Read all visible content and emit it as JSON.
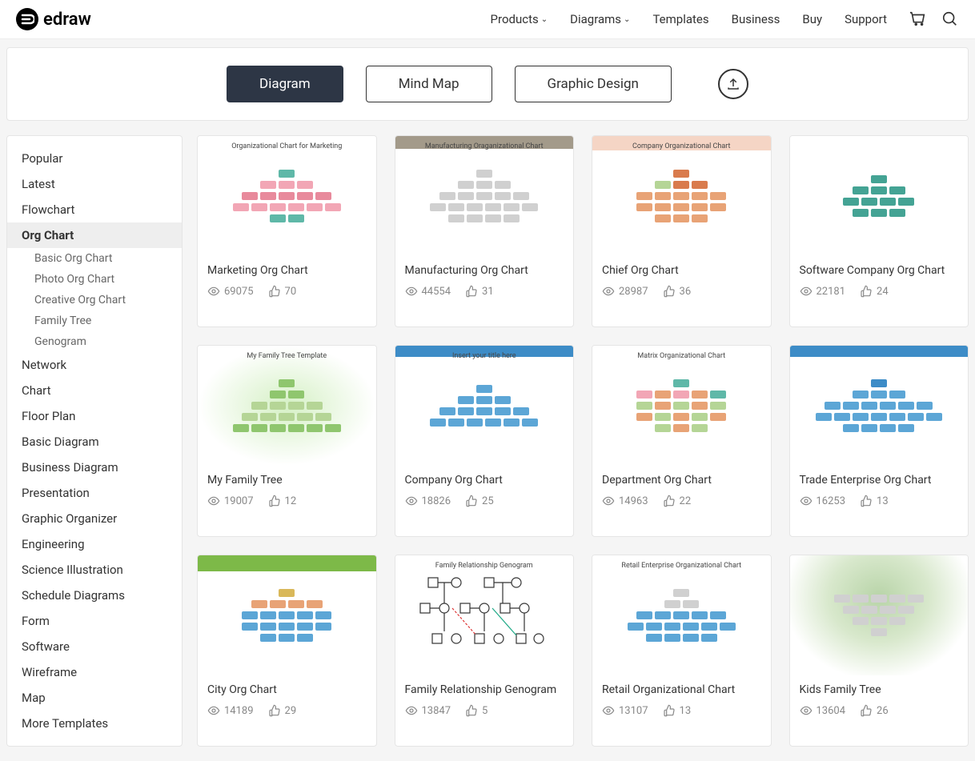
{
  "header": {
    "logo_text": "edraw",
    "nav": [
      "Products",
      "Diagrams",
      "Templates",
      "Business",
      "Buy",
      "Support"
    ],
    "nav_dropdown": [
      true,
      true,
      false,
      false,
      false,
      false
    ]
  },
  "tabs": {
    "items": [
      "Diagram",
      "Mind Map",
      "Graphic Design"
    ],
    "active_index": 0
  },
  "sidebar": {
    "items": [
      {
        "label": "Popular",
        "type": "item"
      },
      {
        "label": "Latest",
        "type": "item"
      },
      {
        "label": "Flowchart",
        "type": "item"
      },
      {
        "label": "Org Chart",
        "type": "item",
        "active": true
      },
      {
        "label": "Basic Org Chart",
        "type": "sub"
      },
      {
        "label": "Photo Org Chart",
        "type": "sub"
      },
      {
        "label": "Creative Org Chart",
        "type": "sub"
      },
      {
        "label": "Family Tree",
        "type": "sub"
      },
      {
        "label": "Genogram",
        "type": "sub"
      },
      {
        "label": "Network",
        "type": "item"
      },
      {
        "label": "Chart",
        "type": "item"
      },
      {
        "label": "Floor Plan",
        "type": "item"
      },
      {
        "label": "Basic Diagram",
        "type": "item"
      },
      {
        "label": "Business Diagram",
        "type": "item"
      },
      {
        "label": "Presentation",
        "type": "item"
      },
      {
        "label": "Graphic Organizer",
        "type": "item"
      },
      {
        "label": "Engineering",
        "type": "item"
      },
      {
        "label": "Science Illustration",
        "type": "item"
      },
      {
        "label": "Schedule Diagrams",
        "type": "item"
      },
      {
        "label": "Form",
        "type": "item"
      },
      {
        "label": "Software",
        "type": "item"
      },
      {
        "label": "Wireframe",
        "type": "item"
      },
      {
        "label": "Map",
        "type": "item"
      },
      {
        "label": "More Templates",
        "type": "item"
      }
    ]
  },
  "templates": [
    {
      "title": "Marketing Org Chart",
      "views": "69075",
      "likes": "70",
      "thumb_label": "Organizational Chart for Marketing",
      "style": "pink"
    },
    {
      "title": "Manufacturing Org Chart",
      "views": "44554",
      "likes": "31",
      "thumb_label": "Manufacturing Oraganizational Chart",
      "style": "gray"
    },
    {
      "title": "Chief Org Chart",
      "views": "28987",
      "likes": "36",
      "thumb_label": "Company Organizational Chart",
      "style": "orange"
    },
    {
      "title": "Software Company Org Chart",
      "views": "22181",
      "likes": "24",
      "thumb_label": "",
      "style": "teal"
    },
    {
      "title": "My Family Tree",
      "views": "19007",
      "likes": "12",
      "thumb_label": "My Family Tree Template",
      "style": "tree"
    },
    {
      "title": "Company Org Chart",
      "views": "18826",
      "likes": "25",
      "thumb_label": "Insert your title here",
      "style": "bluephoto"
    },
    {
      "title": "Department Org Chart",
      "views": "14963",
      "likes": "22",
      "thumb_label": "Matrix Organizational Chart",
      "style": "matrix"
    },
    {
      "title": "Trade Enterprise Org Chart",
      "views": "16253",
      "likes": "13",
      "thumb_label": "",
      "style": "bluewide"
    },
    {
      "title": "City Org Chart",
      "views": "14189",
      "likes": "29",
      "thumb_label": "",
      "style": "city"
    },
    {
      "title": "Family Relationship Genogram",
      "views": "13847",
      "likes": "5",
      "thumb_label": "Family Relationship Genogram",
      "style": "genogram"
    },
    {
      "title": "Retail Organizational Chart",
      "views": "13107",
      "likes": "13",
      "thumb_label": "Retail Enterprise Organizational Chart",
      "style": "retail"
    },
    {
      "title": "Kids Family Tree",
      "views": "13604",
      "likes": "26",
      "thumb_label": "",
      "style": "kids"
    }
  ]
}
